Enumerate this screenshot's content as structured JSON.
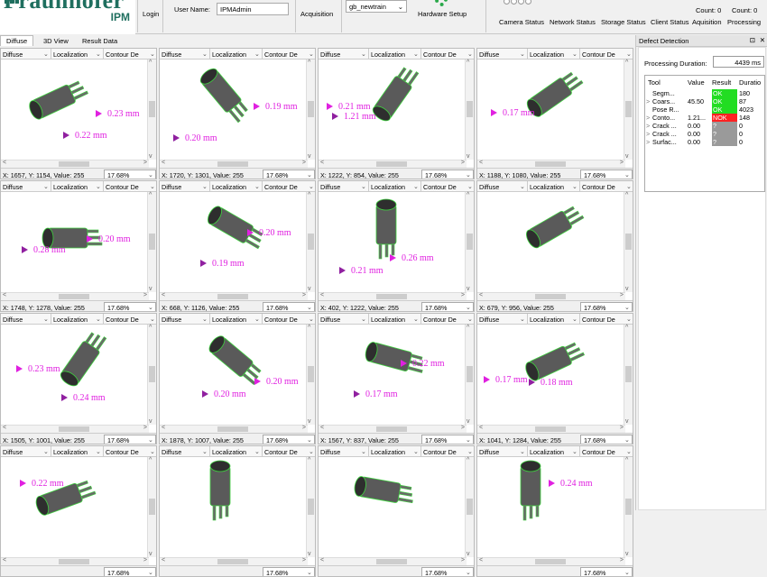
{
  "header": {
    "logo_text": "Fraunhofer",
    "logo_sub": "IPM",
    "login_label": "Login",
    "user_name_label": "User Name:",
    "user_name_value": "IPMAdmin",
    "acquisition_label": "Acquisition",
    "dataset_value": "gb_newtrain",
    "hardware_setup_label": "Hardware Setup",
    "count1": "Count: 0",
    "count2": "Count: 0",
    "status_labels": [
      "Camera Status",
      "Network Status",
      "Storage Status",
      "Client Status",
      "Aquisition",
      "Processing"
    ]
  },
  "tabs": [
    "Diffuse",
    "3D View",
    "Result Data"
  ],
  "dropdown_labels": [
    "Diffuse",
    "Localization",
    "Contour De"
  ],
  "zoom_value": "17.68%",
  "cells": [
    {
      "coords": "X: 1657, Y: 1154, Value: 255",
      "meas": [
        "0.23 mm",
        "0.22 mm"
      ]
    },
    {
      "coords": "X: 1720, Y: 1301, Value: 255",
      "meas": [
        "0.19 mm",
        "0.20 mm"
      ]
    },
    {
      "coords": "X: 1222, Y: 854, Value: 255",
      "meas": [
        "0.21 mm",
        "1.21 mm"
      ]
    },
    {
      "coords": "X: 1188, Y: 1080, Value: 255",
      "meas": [
        "0.17 mm"
      ]
    },
    {
      "coords": "X: 1748, Y: 1278, Value: 255",
      "meas": [
        "0.20 mm",
        "0.28 mm"
      ]
    },
    {
      "coords": "X: 668, Y: 1126, Value: 255",
      "meas": [
        "0.20 mm",
        "0.19 mm"
      ]
    },
    {
      "coords": "X: 402, Y: 1222, Value: 255",
      "meas": [
        "0.26 mm",
        "0.21 mm"
      ]
    },
    {
      "coords": "X: 679, Y: 956, Value: 255",
      "meas": []
    },
    {
      "coords": "X: 1505, Y: 1001, Value: 255",
      "meas": [
        "0.23 mm",
        "0.24 mm"
      ]
    },
    {
      "coords": "X: 1878, Y: 1007, Value: 255",
      "meas": [
        "0.20 mm",
        "0.20 mm"
      ]
    },
    {
      "coords": "X: 1567, Y: 837, Value: 255",
      "meas": [
        "0.22 mm",
        "0.17 mm"
      ]
    },
    {
      "coords": "X: 1041, Y: 1284, Value: 255",
      "meas": [
        "0.17 mm",
        "0.18 mm"
      ]
    },
    {
      "coords": "",
      "meas": [
        "0.22 mm"
      ]
    },
    {
      "coords": "",
      "meas": []
    },
    {
      "coords": "",
      "meas": []
    },
    {
      "coords": "",
      "meas": [
        "0.24 mm"
      ]
    }
  ],
  "panel": {
    "title": "Defect Detection",
    "duration_label": "Processing Duration:",
    "duration_value": "4439 ms",
    "columns": [
      "Tool",
      "Value",
      "Result",
      "Duratio"
    ],
    "rows": [
      {
        "expander": "",
        "tool": "Segm...",
        "value": "",
        "result": "OK",
        "duration": "180"
      },
      {
        "expander": ">",
        "tool": "Coars...",
        "value": "45.50",
        "result": "OK",
        "duration": "87"
      },
      {
        "expander": "",
        "tool": "Pose R...",
        "value": "",
        "result": "OK",
        "duration": "4023"
      },
      {
        "expander": ">",
        "tool": "Conto...",
        "value": "1.21...",
        "result": "NOK",
        "duration": "148"
      },
      {
        "expander": ">",
        "tool": "Crack ...",
        "value": "0.00",
        "result": "?",
        "duration": "0"
      },
      {
        "expander": ">",
        "tool": "Crack ...",
        "value": "0.00",
        "result": "?",
        "duration": "0"
      },
      {
        "expander": ">",
        "tool": "Surfac...",
        "value": "0.00",
        "result": "?",
        "duration": "0"
      }
    ]
  },
  "colors": {
    "ok": "#22dd22",
    "nok": "#ff2222",
    "unknown": "#9a9a9a",
    "measure": "#e020e0",
    "arrow": "#9020a0",
    "brand": "#1f6f5f"
  },
  "icons": {
    "hardware": "gear-icon",
    "status": "status-circle-icon",
    "pin": "pin-icon",
    "close": "close-icon"
  }
}
